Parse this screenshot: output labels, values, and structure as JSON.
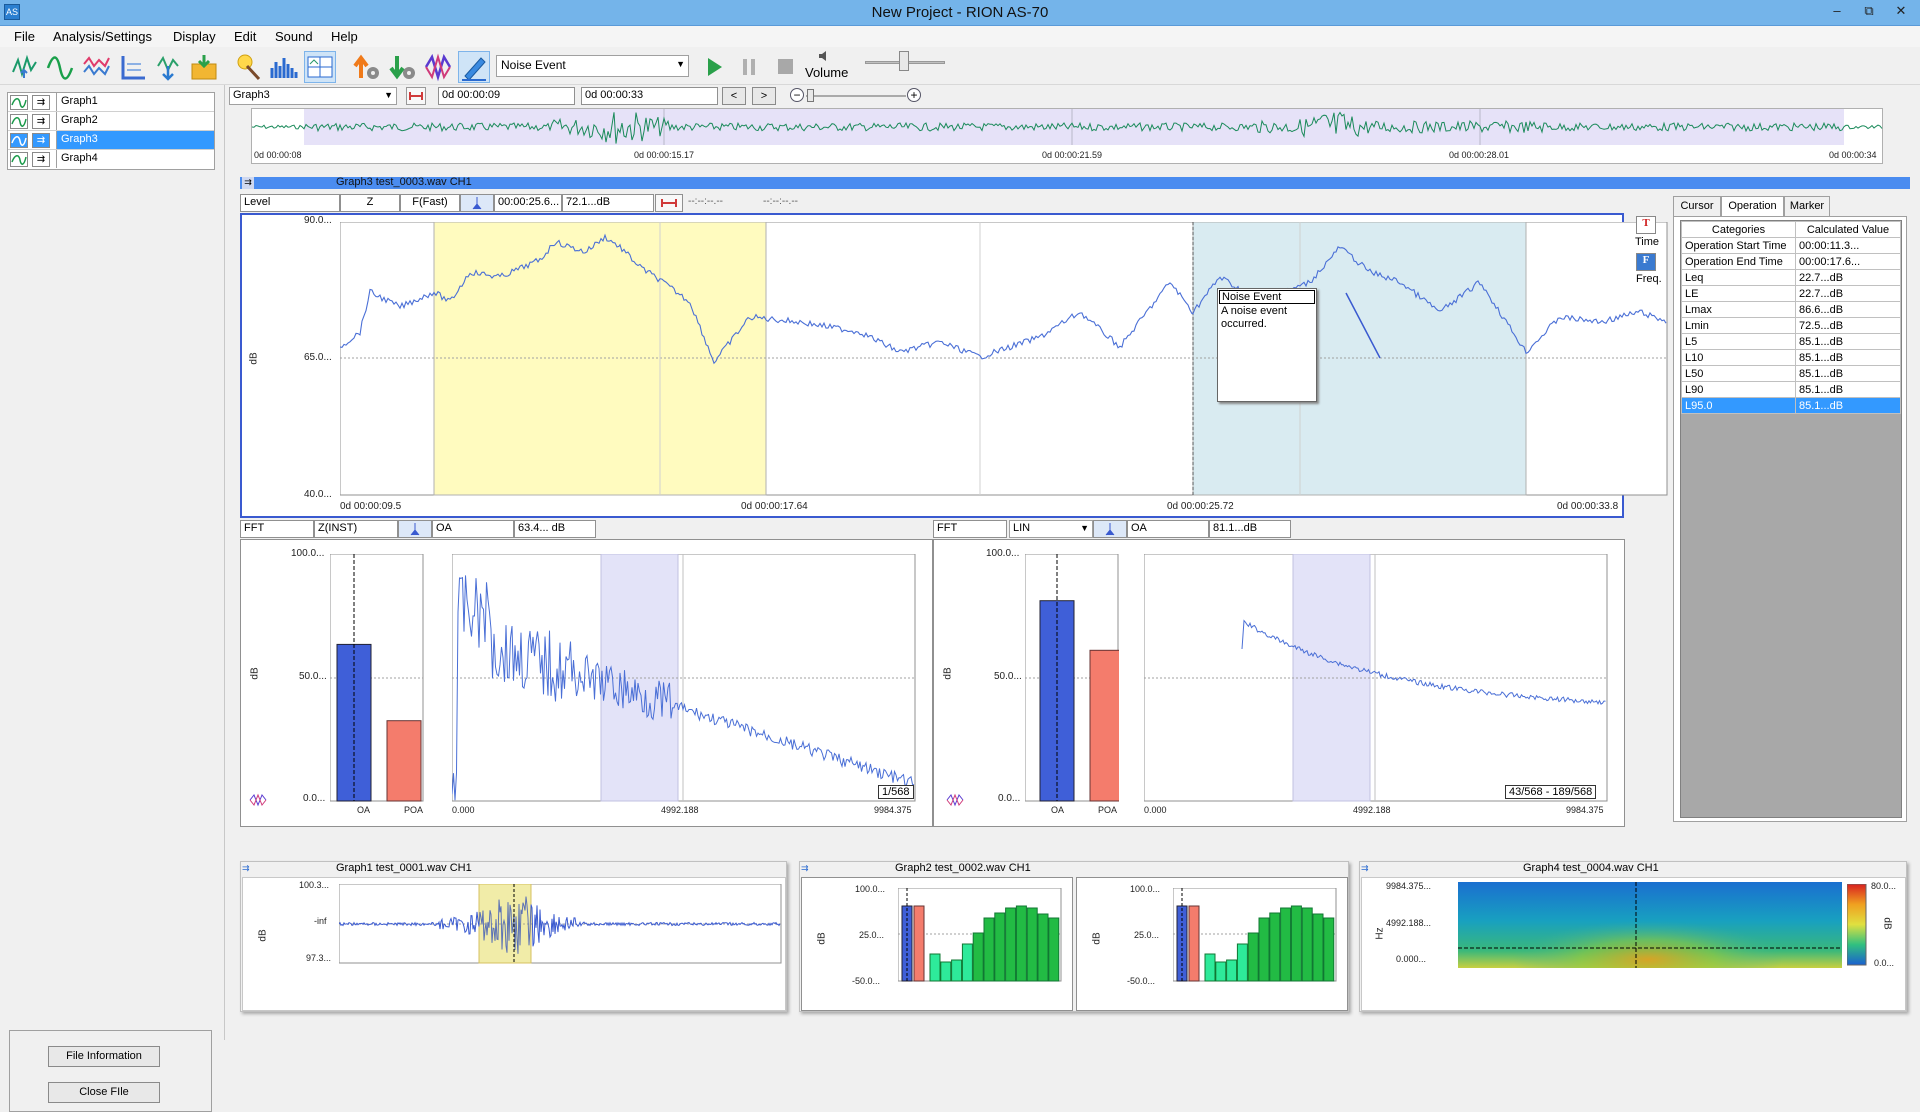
{
  "window": {
    "title": "New Project - RION AS-70",
    "minimize": "–",
    "maximize": "⧉",
    "close": "✕"
  },
  "menu": [
    "File",
    "Analysis/Settings",
    "Display",
    "Edit",
    "Sound",
    "Help"
  ],
  "toolbar": {
    "event_select": "Noise Event",
    "volume_label": "Volume",
    "volume_level": 0.45
  },
  "graph_list": {
    "items": [
      "Graph1",
      "Graph2",
      "Graph3",
      "Graph4"
    ],
    "selected": "Graph3"
  },
  "left_buttons": {
    "file_info": "File Information",
    "close_file": "Close FIle"
  },
  "timebar": {
    "graph_select": "Graph3",
    "start": "0d 00:00:09",
    "end": "0d 00:00:33",
    "prev": "<",
    "next": ">",
    "zoom_minus": "−",
    "zoom_plus": "+",
    "overview_ticks": [
      "0d 00:00:08",
      "0d 00:00:15.17",
      "0d 00:00:21.59",
      "0d 00:00:28.01",
      "0d 00:00:34"
    ]
  },
  "graph3": {
    "title": "Graph3  test_0003.wav  CH1",
    "level_label": "Level",
    "weighting": "Z",
    "time_weighting": "F(Fast)",
    "cursor_time": "00:00:25.6...",
    "cursor_value": "72.1...dB",
    "cursor2_time": "--:--:--.--",
    "cursor2_value": "--:--:--.--",
    "y_unit": "dB",
    "y_ticks": [
      "90.0...",
      "65.0...",
      "40.0..."
    ],
    "x_ticks": [
      "0d 00:00:09.5",
      "0d 00:00:17.64",
      "0d 00:00:25.72",
      "0d 00:00:33.8"
    ],
    "time_label": "Time",
    "freq_label": "Freq.",
    "t_icon": "T",
    "f_icon": "F",
    "annotation_title": "Noise Event",
    "annotation_text": "A noise event occurred."
  },
  "fft_left": {
    "label": "FFT",
    "mode": "Z(INST)",
    "oa_label": "OA",
    "oa_value": "63.4... dB",
    "y_unit": "dB",
    "y_ticks": [
      "100.0...",
      "50.0...",
      "0.0..."
    ],
    "bar_labels": [
      "OA",
      "POA"
    ],
    "x_ticks": [
      "0.000",
      "4992.188",
      "9984.375"
    ],
    "page": "1/568"
  },
  "fft_right": {
    "label": "FFT",
    "mode": "LIN",
    "oa_label": "OA",
    "oa_value": "81.1...dB",
    "y_unit": "dB",
    "y_ticks": [
      "100.0...",
      "50.0...",
      "0.0..."
    ],
    "bar_labels": [
      "OA",
      "POA"
    ],
    "x_ticks": [
      "0.000",
      "4992.188",
      "9984.375"
    ],
    "page": "43/568 - 189/568"
  },
  "side_tabs": [
    "Cursor",
    "Operation",
    "Marker"
  ],
  "side_table": {
    "headers": [
      "Categories",
      "Calculated Value"
    ],
    "rows": [
      [
        "Operation Start Time",
        "00:00:11.3..."
      ],
      [
        "Operation End Time",
        "00:00:17.6..."
      ],
      [
        "Leq",
        "22.7...dB"
      ],
      [
        "LE",
        "22.7...dB"
      ],
      [
        "Lmax",
        "86.6...dB"
      ],
      [
        "Lmin",
        "72.5...dB"
      ],
      [
        "L5",
        "85.1...dB"
      ],
      [
        "L10",
        "85.1...dB"
      ],
      [
        "L50",
        "85.1...dB"
      ],
      [
        "L90",
        "85.1...dB"
      ],
      [
        "L95.0",
        "85.1...dB"
      ]
    ]
  },
  "graph1": {
    "title": "Graph1  test_0001.wav  CH1",
    "y_unit": "dB",
    "y_ticks": [
      "100.3...",
      "-inf",
      "97.3..."
    ]
  },
  "graph2": {
    "title": "Graph2  test_0002.wav  CH1",
    "y_unit": "dB",
    "y_ticks": [
      "100.0...",
      "25.0...",
      "-50.0..."
    ]
  },
  "graph4": {
    "title": "Graph4  test_0004.wav  CH1",
    "y_unit": "Hz",
    "y_ticks": [
      "9984.375...",
      "4992.188...",
      "0.000..."
    ],
    "scale_max": "80.0...",
    "scale_min": "0.0...",
    "scale_unit": "dB"
  },
  "colors": {
    "accent": "#3399ff",
    "oa_bar": "#3f5fd8",
    "poa_bar": "#f47c6c",
    "trace": "#4a6fd6",
    "highlight_yellow": "#fffbbf",
    "highlight_blue": "#d9ebf1",
    "fft_band": "#e3e3f8",
    "green_bar": "#22bb44"
  }
}
